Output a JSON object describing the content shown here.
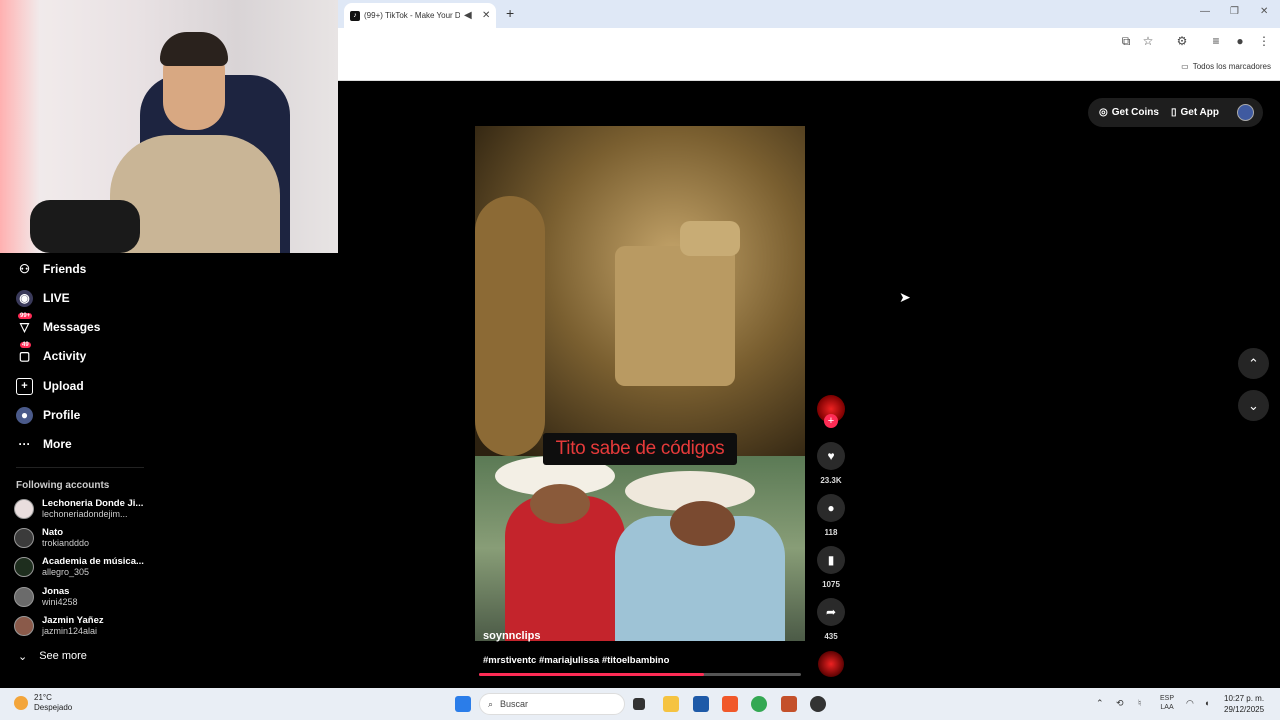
{
  "browser": {
    "tab_title": "(99+) TikTok - Make Your D...",
    "tab_favicon": "tiktok-icon",
    "new_tab": "+",
    "bookmarks_label": "Todos los marcadores"
  },
  "sidebar": {
    "items": [
      {
        "label": "Friends",
        "icon": "friends-icon"
      },
      {
        "label": "LIVE",
        "icon": "live-icon"
      },
      {
        "label": "Messages",
        "icon": "messages-icon",
        "badge": "99+"
      },
      {
        "label": "Activity",
        "icon": "activity-icon",
        "badge": "49"
      },
      {
        "label": "Upload",
        "icon": "upload-icon"
      },
      {
        "label": "Profile",
        "icon": "profile-icon"
      },
      {
        "label": "More",
        "icon": "more-icon"
      }
    ],
    "following_title": "Following accounts",
    "following": [
      {
        "name": "Lechoneria Donde Ji...",
        "handle": "lechoneriadondejim..."
      },
      {
        "name": "Nato",
        "handle": "trokiandddo"
      },
      {
        "name": "Academia de música...",
        "handle": "allegro_305"
      },
      {
        "name": "Jonas",
        "handle": "wini4258"
      },
      {
        "name": "Jazmin Yañez",
        "handle": "jazmin124alai"
      }
    ],
    "see_more": "See more"
  },
  "video": {
    "caption": "Tito sabe de códigos",
    "author": "soynnclips",
    "hashtags": "#mrstiventc #mariajulissa #titoelbambino",
    "progress": 0.7
  },
  "actions": {
    "likes": "23.3K",
    "comments": "118",
    "saves": "1075",
    "shares": "435"
  },
  "topbar": {
    "get_coins": "Get Coins",
    "get_app": "Get App"
  },
  "taskbar": {
    "weather_temp": "21°C",
    "weather_desc": "Despejado",
    "search_placeholder": "Buscar",
    "lang_top": "ESP",
    "lang_bottom": "LAA",
    "time": "10:27 p. m.",
    "date": "29/12/2025"
  },
  "colors": {
    "accent": "#fe2c55",
    "caption_text": "#e53a3a",
    "taskbar_bg": "#e9eef5"
  }
}
